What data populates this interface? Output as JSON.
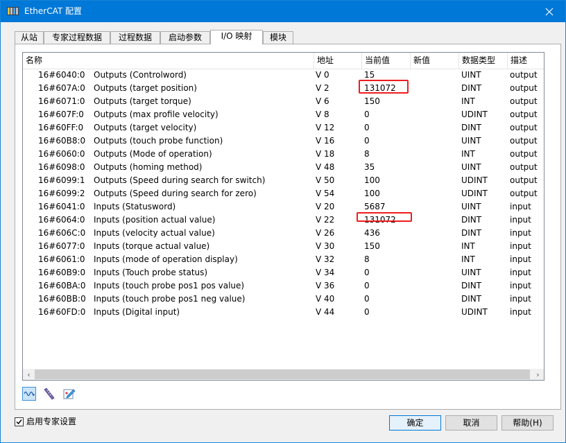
{
  "window": {
    "title": "EtherCAT 配置",
    "icon": "ethercat-app-icon"
  },
  "tabs": [
    {
      "label": "从站"
    },
    {
      "label": "专家过程数据"
    },
    {
      "label": "过程数据"
    },
    {
      "label": "启动参数"
    },
    {
      "label": "I/O 映射",
      "active": true
    },
    {
      "label": "模块"
    }
  ],
  "columns": [
    "名称",
    "地址",
    "当前值",
    "新值",
    "数据类型",
    "描述"
  ],
  "rows": [
    {
      "index": "16#6040:0",
      "name": "Outputs (Controlword)",
      "address": "V 0",
      "current": "15",
      "new": "",
      "type": "UINT",
      "desc": "output"
    },
    {
      "index": "16#607A:0",
      "name": "Outputs (target position)",
      "address": "V 2",
      "current": "131072",
      "new": "",
      "type": "DINT",
      "desc": "output"
    },
    {
      "index": "16#6071:0",
      "name": "Outputs (target torque)",
      "address": "V 6",
      "current": "150",
      "new": "",
      "type": "INT",
      "desc": "output"
    },
    {
      "index": "16#607F:0",
      "name": "Outputs (max profile velocity)",
      "address": "V 8",
      "current": "0",
      "new": "",
      "type": "UDINT",
      "desc": "output"
    },
    {
      "index": "16#60FF:0",
      "name": "Outputs (target velocity)",
      "address": "V 12",
      "current": "0",
      "new": "",
      "type": "DINT",
      "desc": "output"
    },
    {
      "index": "16#60B8:0",
      "name": "Outputs (touch probe function)",
      "address": "V 16",
      "current": "0",
      "new": "",
      "type": "UINT",
      "desc": "output"
    },
    {
      "index": "16#6060:0",
      "name": "Outputs (Mode of operation)",
      "address": "V 18",
      "current": "8",
      "new": "",
      "type": "INT",
      "desc": "output"
    },
    {
      "index": "16#6098:0",
      "name": "Outputs (homing method)",
      "address": "V 48",
      "current": "35",
      "new": "",
      "type": "UINT",
      "desc": "output"
    },
    {
      "index": "16#6099:1",
      "name": "Outputs (Speed during search for switch)",
      "address": "V 50",
      "current": "100",
      "new": "",
      "type": "UDINT",
      "desc": "output"
    },
    {
      "index": "16#6099:2",
      "name": "Outputs (Speed during search for zero)",
      "address": "V 54",
      "current": "100",
      "new": "",
      "type": "UDINT",
      "desc": "output"
    },
    {
      "index": "16#6041:0",
      "name": "Inputs (Statusword)",
      "address": "V 20",
      "current": "5687",
      "new": "",
      "type": "UINT",
      "desc": "input"
    },
    {
      "index": "16#6064:0",
      "name": "Inputs (position actual value)",
      "address": "V 22",
      "current": "131072",
      "new": "",
      "type": "DINT",
      "desc": "input"
    },
    {
      "index": "16#606C:0",
      "name": "Inputs (velocity actual value)",
      "address": "V 26",
      "current": "436",
      "new": "",
      "type": "DINT",
      "desc": "input"
    },
    {
      "index": "16#6077:0",
      "name": "Inputs (torque actual value)",
      "address": "V 30",
      "current": "150",
      "new": "",
      "type": "INT",
      "desc": "input"
    },
    {
      "index": "16#6061:0",
      "name": "Inputs (mode of operation display)",
      "address": "V 32",
      "current": "8",
      "new": "",
      "type": "INT",
      "desc": "input"
    },
    {
      "index": "16#60B9:0",
      "name": "Inputs (Touch probe status)",
      "address": "V 34",
      "current": "0",
      "new": "",
      "type": "UINT",
      "desc": "input"
    },
    {
      "index": "16#60BA:0",
      "name": "Inputs (touch probe pos1 pos value)",
      "address": "V 36",
      "current": "0",
      "new": "",
      "type": "DINT",
      "desc": "input"
    },
    {
      "index": "16#60BB:0",
      "name": "Inputs (touch probe pos1 neg value)",
      "address": "V 40",
      "current": "0",
      "new": "",
      "type": "DINT",
      "desc": "input"
    },
    {
      "index": "16#60FD:0",
      "name": "Inputs (Digital input)",
      "address": "V 44",
      "current": "0",
      "new": "",
      "type": "UDINT",
      "desc": "input"
    }
  ],
  "highlight_color": "#ee1c1c",
  "toolbar_icons": [
    "waveform-icon",
    "ruler-icon",
    "edit-icon"
  ],
  "expert_settings": {
    "label": "启用专家设置",
    "checked": true
  },
  "buttons": {
    "ok": "确定",
    "cancel": "取消",
    "help": "帮助(H)"
  }
}
